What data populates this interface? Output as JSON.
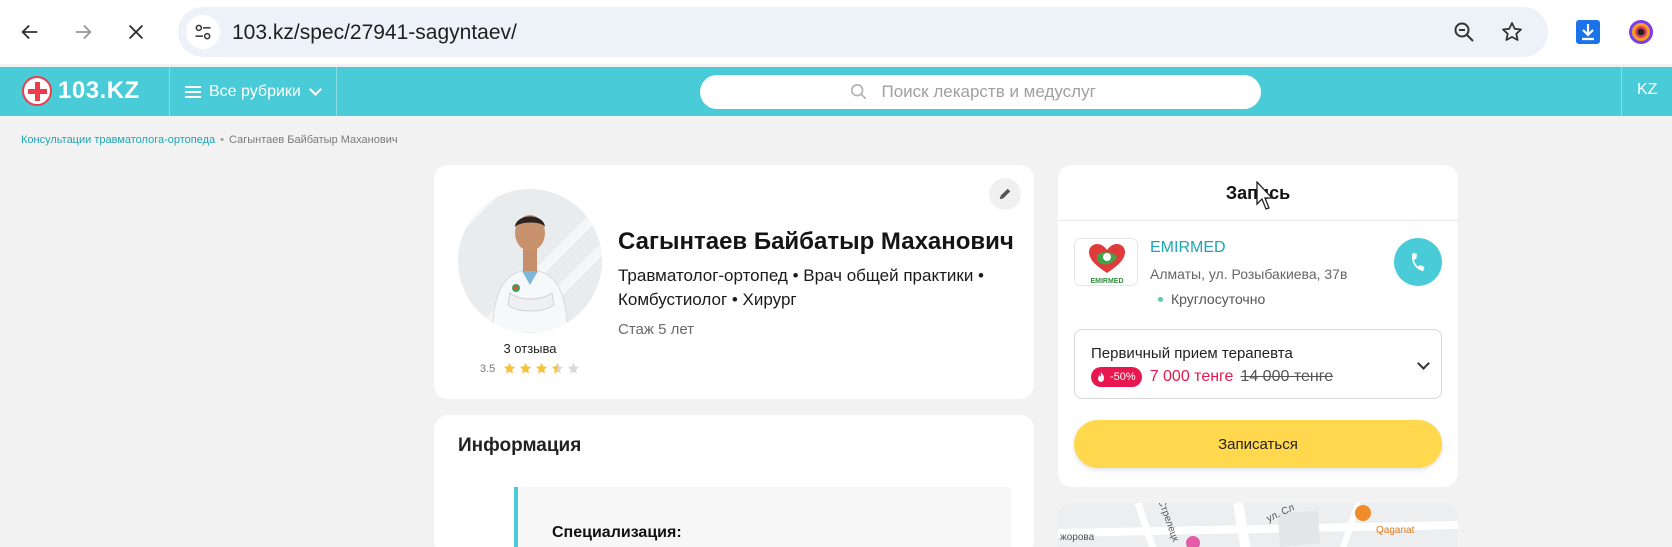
{
  "browser": {
    "url": "103.kz/spec/27941-sagyntaev/",
    "icons": [
      "back-arrow-icon",
      "forward-arrow-icon",
      "close-icon",
      "site-settings-icon",
      "zoom-icon",
      "bookmark-star-icon",
      "download-icon",
      "extension-icon"
    ]
  },
  "header": {
    "logo_text": "103.KZ",
    "rubrics_label": "Все рубрики",
    "search_placeholder": "Поиск лекарств и медуслуг",
    "lang": "KZ",
    "bg_color": "#49ccd8"
  },
  "breadcrumb": {
    "items": [
      "Консультации травматолога-ортопеда",
      "Сагынтаев Байбатыр Маханович"
    ],
    "separator": "•"
  },
  "profile": {
    "name": "Сагынтаев Байбатыр Маханович",
    "specialties": "Травматолог-ортопед • Врач общей практики • Комбустиолог • Хирург",
    "experience": "Стаж 5 лет",
    "reviews": "3 отзыва",
    "rating_value": "3.5",
    "rating_stars": 3.5,
    "rating_max": 5
  },
  "info": {
    "title": "Информация",
    "specialization_label": "Специализация:"
  },
  "booking": {
    "title": "Запись",
    "clinic_name": "EMIRMED",
    "clinic_logo_text": "EMIRMED",
    "clinic_address": "Алматы, ул. Розыбакиева, 37в",
    "clinic_hours": "Круглосуточно",
    "service_name": "Первичный прием терапевта",
    "discount": "-50%",
    "price_new": "7 000 тенге",
    "price_old": "14 000 тенге",
    "book_button": "Записаться",
    "accent_color": "#ffd84e",
    "price_color": "#e8174f"
  },
  "map": {
    "labels": [
      "Qaganat",
      "ул. Сл",
      "жорова",
      "Стрелецк"
    ]
  }
}
